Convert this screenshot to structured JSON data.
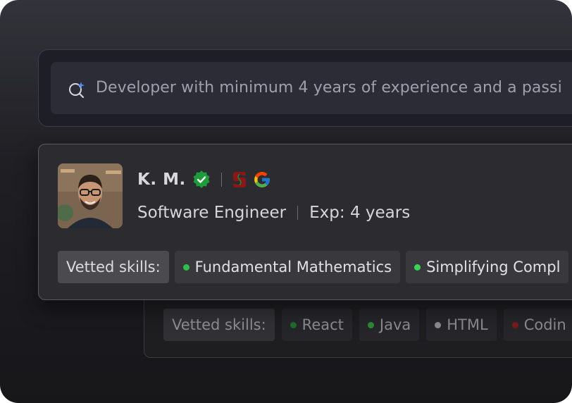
{
  "search": {
    "query": "Developer with minimum 4 years of experience and a passi"
  },
  "candidate": {
    "name": "K. M.",
    "role": "Software Engineer",
    "experience_label": "Exp:",
    "experience_value": "4 years",
    "skills_label": "Vetted skills:",
    "skills": [
      {
        "label": "Fundamental Mathematics",
        "color": "#2fbf4a"
      },
      {
        "label": "Simplifying Compl",
        "color": "#3ad35a"
      }
    ]
  },
  "candidate_back": {
    "skills_label": "Vetted skills:",
    "skills": [
      {
        "label": "React",
        "color": "#1f6b2a"
      },
      {
        "label": "Java",
        "color": "#2a8a35"
      },
      {
        "label": "HTML",
        "color": "#8a8a90"
      },
      {
        "label": "Codin",
        "color": "#7a1a1a"
      }
    ]
  },
  "icons": {
    "verified": "verified-badge-icon",
    "university": "stanford-logo-icon",
    "company": "google-logo-icon",
    "search": "ai-search-icon"
  }
}
